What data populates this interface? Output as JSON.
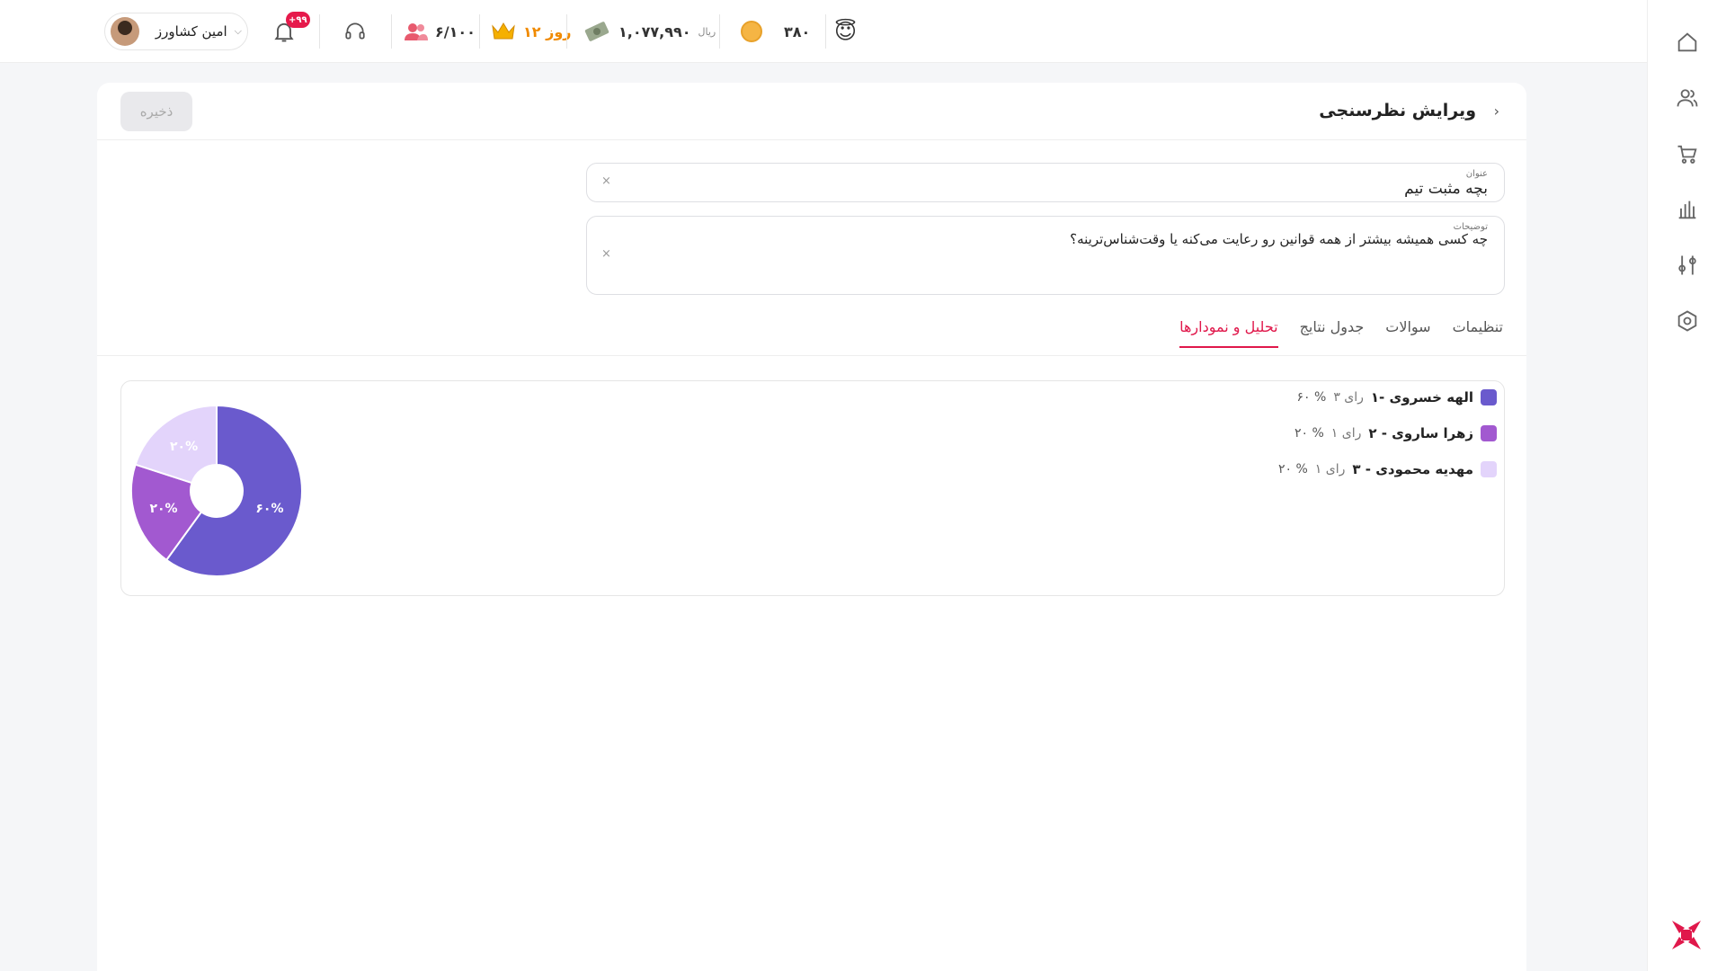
{
  "topbar": {
    "user_name": "امین کشاورز",
    "notifications_badge": "+۹۹",
    "members": "۶/۱۰۰",
    "days": "۱۲ روز",
    "balance": "۱,۰۷۷,۹۹۰",
    "currency": "ریال",
    "coins": "۳۸۰",
    "emoji": "😇"
  },
  "page": {
    "title": "ویرایش نظرسنجی",
    "save_label": "ذخیره"
  },
  "form": {
    "title_label": "عنوان",
    "title_value": "بچه مثبت تیم",
    "desc_label": "توضیحات",
    "desc_value": "چه کسی همیشه بیشتر از همه قوانین رو رعایت می‌کنه یا وقت‌شناس‌ترینه؟",
    "clear_symbol": "×"
  },
  "tabs": [
    {
      "label": "تنظیمات",
      "active": false
    },
    {
      "label": "سوالات",
      "active": false
    },
    {
      "label": "جدول نتایج",
      "active": false
    },
    {
      "label": "تحلیل و نمودارها",
      "active": true
    }
  ],
  "chart_data": {
    "type": "pie",
    "donut": true,
    "items": [
      {
        "label": "۱- الهه خسروی",
        "votes_text": "۳ رای",
        "pct_text": "۶۰ %",
        "value": 60,
        "slice_label": "۶۰%",
        "color": "#6a5acd"
      },
      {
        "label": "۲ - زهرا ساروی",
        "votes_text": "۱ رای",
        "pct_text": "۲۰ %",
        "value": 20,
        "slice_label": "۲۰%",
        "color": "#a259d0"
      },
      {
        "label": "۳ - مهدیه محمودی",
        "votes_text": "۱ رای",
        "pct_text": "۲۰ %",
        "value": 20,
        "slice_label": "۲۰%",
        "color": "#e3d4fb"
      }
    ]
  },
  "colors": {
    "accent": "#e0184b",
    "logo": "#e0184b"
  },
  "icons": [
    "home-icon",
    "users-icon",
    "cart-icon",
    "chart-icon",
    "settings-sliders-icon",
    "hexagon-icon",
    "bell-icon",
    "headset-icon",
    "members-icon",
    "crown-icon",
    "money-icon",
    "coin-icon"
  ]
}
